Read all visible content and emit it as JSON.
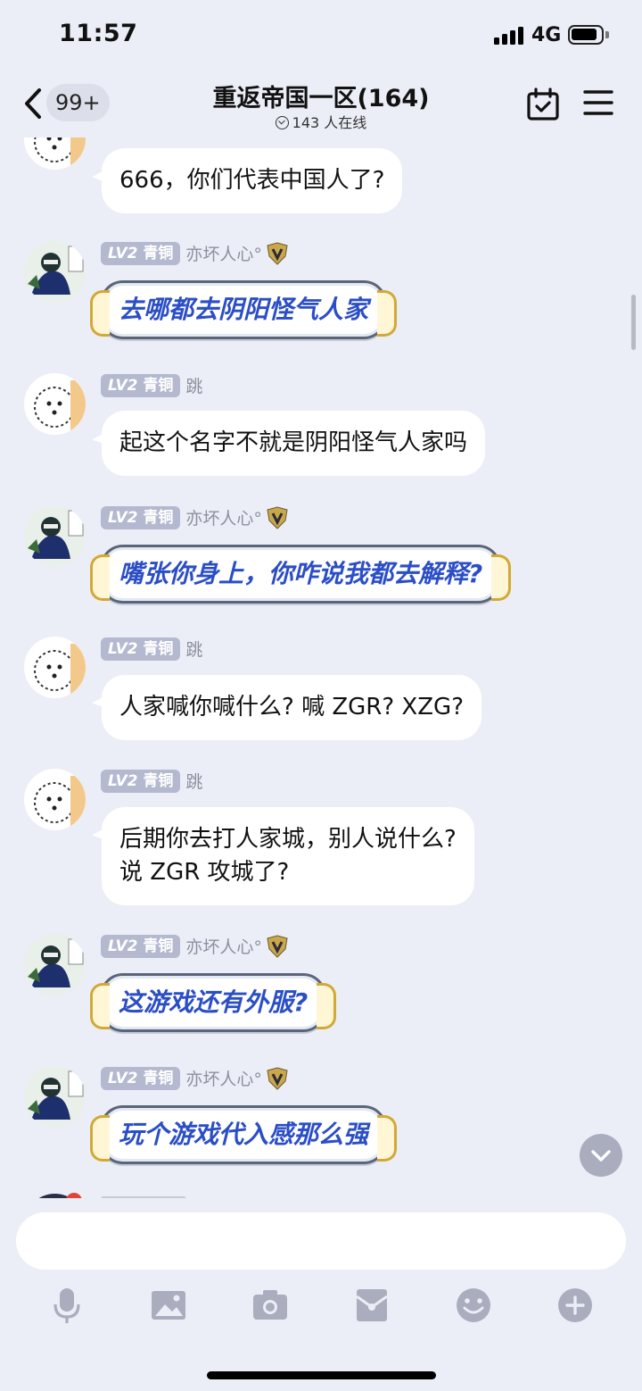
{
  "status": {
    "time": "11:57",
    "network": "4G"
  },
  "header": {
    "unread_count": "99+",
    "title": "重返帝国一区(164)",
    "online": "143 人在线"
  },
  "messages": [
    {
      "id": "m1",
      "sender": "",
      "level_badge": "",
      "text": "666，你们代表中国人了?",
      "style": "plain"
    },
    {
      "id": "m2",
      "sender": "亦坏人心°",
      "level_badge": "LV2 青铜",
      "text": "去哪都去阴阳怪气人家",
      "style": "fancy"
    },
    {
      "id": "m3",
      "sender": "跳",
      "level_badge": "LV2 青铜",
      "text": "起这个名字不就是阴阳怪气人家吗",
      "style": "plain"
    },
    {
      "id": "m4",
      "sender": "亦坏人心°",
      "level_badge": "LV2 青铜",
      "text": "嘴张你身上，你咋说我都去解释?",
      "style": "fancy"
    },
    {
      "id": "m5",
      "sender": "跳",
      "level_badge": "LV2 青铜",
      "text": "人家喊你喊什么? 喊 ZGR? XZG?",
      "style": "plain"
    },
    {
      "id": "m6",
      "sender": "跳",
      "level_badge": "LV2 青铜",
      "text_line1": "后期你去打人家城，别人说什么?",
      "text_line2": "说 ZGR 攻城了?",
      "style": "plain"
    },
    {
      "id": "m7",
      "sender": "亦坏人心°",
      "level_badge": "LV2 青铜",
      "text": "这游戏还有外服?",
      "style": "fancy"
    },
    {
      "id": "m8",
      "sender": "亦坏人心°",
      "level_badge": "LV2 青铜",
      "text": "玩个游戏代入感那么强",
      "style": "fancy"
    }
  ],
  "level": {
    "lv": "LV2",
    "rank": "青铜"
  },
  "input": {
    "placeholder": ""
  },
  "toolbar_icons": [
    "microphone-icon",
    "image-icon",
    "camera-icon",
    "red-packet-icon",
    "emoji-icon",
    "plus-icon"
  ],
  "colors": {
    "background": "#eceef7",
    "badge": "#b4b9cf",
    "fancy_text": "#2b4ec6",
    "fancy_cap": "#d2a936",
    "toolbar_icon": "#a9adbd"
  }
}
